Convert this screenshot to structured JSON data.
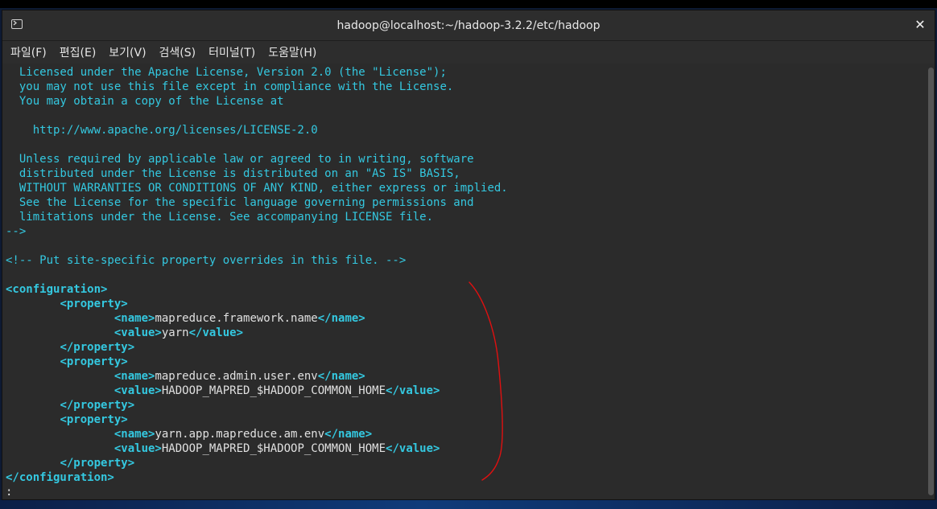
{
  "window": {
    "title": "hadoop@localhost:~/hadoop-3.2.2/etc/hadoop",
    "close_glyph": "✕",
    "icon": "terminal-icon"
  },
  "menu": [
    {
      "label": "파일(F)"
    },
    {
      "label": "편집(E)"
    },
    {
      "label": "보기(V)"
    },
    {
      "label": "검색(S)"
    },
    {
      "label": "터미널(T)"
    },
    {
      "label": "도움말(H)"
    }
  ],
  "terminal": {
    "lines": [
      [
        {
          "t": "  Licensed under the Apache License, Version 2.0 (the \"License\");",
          "k": "c"
        }
      ],
      [
        {
          "t": "  you may not use this file except in compliance with the License.",
          "k": "c"
        }
      ],
      [
        {
          "t": "  You may obtain a copy of the License at",
          "k": "c"
        }
      ],
      [
        {
          "t": "",
          "k": "c"
        }
      ],
      [
        {
          "t": "    http://www.apache.org/licenses/LICENSE-2.0",
          "k": "c"
        }
      ],
      [
        {
          "t": "",
          "k": "c"
        }
      ],
      [
        {
          "t": "  Unless required by applicable law or agreed to in writing, software",
          "k": "c"
        }
      ],
      [
        {
          "t": "  distributed under the License is distributed on an \"AS IS\" BASIS,",
          "k": "c"
        }
      ],
      [
        {
          "t": "  WITHOUT WARRANTIES OR CONDITIONS OF ANY KIND, either express or implied.",
          "k": "c"
        }
      ],
      [
        {
          "t": "  See the License for the specific language governing permissions and",
          "k": "c"
        }
      ],
      [
        {
          "t": "  limitations under the License. See accompanying LICENSE file.",
          "k": "c"
        }
      ],
      [
        {
          "t": "-->",
          "k": "c"
        }
      ],
      [
        {
          "t": "",
          "k": "c"
        }
      ],
      [
        {
          "t": "<!-- Put site-specific property overrides in this file. -->",
          "k": "c"
        }
      ],
      [
        {
          "t": "",
          "k": "c"
        }
      ],
      [
        {
          "t": "<configuration>",
          "k": "tag"
        }
      ],
      [
        {
          "t": "        ",
          "k": "txt"
        },
        {
          "t": "<property>",
          "k": "tag"
        }
      ],
      [
        {
          "t": "                ",
          "k": "txt"
        },
        {
          "t": "<name>",
          "k": "tag"
        },
        {
          "t": "mapreduce.framework.name",
          "k": "txt"
        },
        {
          "t": "</name>",
          "k": "tag"
        }
      ],
      [
        {
          "t": "                ",
          "k": "txt"
        },
        {
          "t": "<value>",
          "k": "tag"
        },
        {
          "t": "yarn",
          "k": "txt"
        },
        {
          "t": "</value>",
          "k": "tag"
        }
      ],
      [
        {
          "t": "        ",
          "k": "txt"
        },
        {
          "t": "</property>",
          "k": "tag"
        }
      ],
      [
        {
          "t": "        ",
          "k": "txt"
        },
        {
          "t": "<property>",
          "k": "tag"
        }
      ],
      [
        {
          "t": "                ",
          "k": "txt"
        },
        {
          "t": "<name>",
          "k": "tag"
        },
        {
          "t": "mapreduce.admin.user.env",
          "k": "txt"
        },
        {
          "t": "</name>",
          "k": "tag"
        }
      ],
      [
        {
          "t": "                ",
          "k": "txt"
        },
        {
          "t": "<value>",
          "k": "tag"
        },
        {
          "t": "HADOOP_MAPRED_$HADOOP_COMMON_HOME",
          "k": "txt"
        },
        {
          "t": "</value>",
          "k": "tag"
        }
      ],
      [
        {
          "t": "        ",
          "k": "txt"
        },
        {
          "t": "</property>",
          "k": "tag"
        }
      ],
      [
        {
          "t": "        ",
          "k": "txt"
        },
        {
          "t": "<property>",
          "k": "tag"
        }
      ],
      [
        {
          "t": "                ",
          "k": "txt"
        },
        {
          "t": "<name>",
          "k": "tag"
        },
        {
          "t": "yarn.app.mapreduce.am.env",
          "k": "txt"
        },
        {
          "t": "</name>",
          "k": "tag"
        }
      ],
      [
        {
          "t": "                ",
          "k": "txt"
        },
        {
          "t": "<value>",
          "k": "tag"
        },
        {
          "t": "HADOOP_MAPRED_$HADOOP_COMMON_HOME",
          "k": "txt"
        },
        {
          "t": "</value>",
          "k": "tag"
        }
      ],
      [
        {
          "t": "        ",
          "k": "txt"
        },
        {
          "t": "</property>",
          "k": "tag"
        }
      ],
      [
        {
          "t": "</configuration>",
          "k": "tag"
        }
      ],
      [
        {
          "t": ":",
          "k": "txt"
        }
      ]
    ]
  },
  "colors": {
    "comment": "#34c8e0",
    "tag": "#34c8e0",
    "text": "#e0e0e0",
    "background": "#2b2b2b",
    "annotation": "#e01010"
  }
}
